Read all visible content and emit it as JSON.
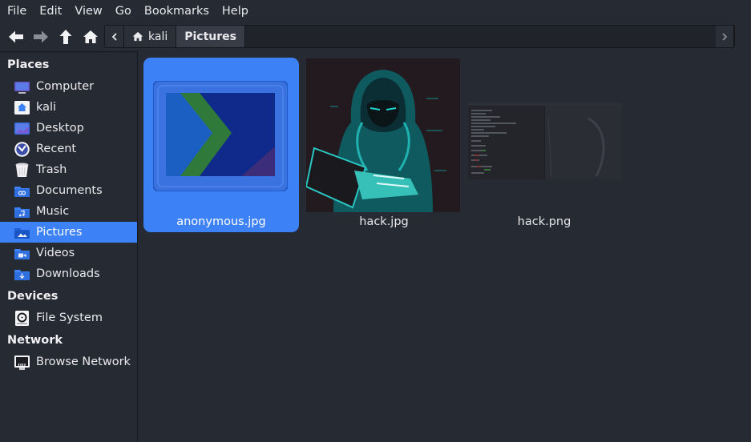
{
  "menu": [
    "File",
    "Edit",
    "View",
    "Go",
    "Bookmarks",
    "Help"
  ],
  "path": {
    "home_label": "kali",
    "current_label": "Pictures"
  },
  "sections": {
    "places": "Places",
    "devices": "Devices",
    "network": "Network"
  },
  "places": [
    {
      "label": "Computer",
      "icon": "computer-icon"
    },
    {
      "label": "kali",
      "icon": "home-folder-icon"
    },
    {
      "label": "Desktop",
      "icon": "desktop-icon"
    },
    {
      "label": "Recent",
      "icon": "recent-icon"
    },
    {
      "label": "Trash",
      "icon": "trash-icon"
    },
    {
      "label": "Documents",
      "icon": "documents-folder-icon"
    },
    {
      "label": "Music",
      "icon": "music-folder-icon"
    },
    {
      "label": "Pictures",
      "icon": "pictures-folder-icon",
      "selected": true
    },
    {
      "label": "Videos",
      "icon": "videos-folder-icon"
    },
    {
      "label": "Downloads",
      "icon": "downloads-folder-icon"
    }
  ],
  "devices": [
    {
      "label": "File System",
      "icon": "drive-icon"
    }
  ],
  "network": [
    {
      "label": "Browse Network",
      "icon": "network-icon"
    }
  ],
  "files": [
    {
      "name": "anonymous.jpg",
      "selected": true
    },
    {
      "name": "hack.jpg"
    },
    {
      "name": "hack.png"
    }
  ],
  "colors": {
    "accent": "#3d81f6",
    "background": "#262a33",
    "text": "#e9e9ec"
  }
}
